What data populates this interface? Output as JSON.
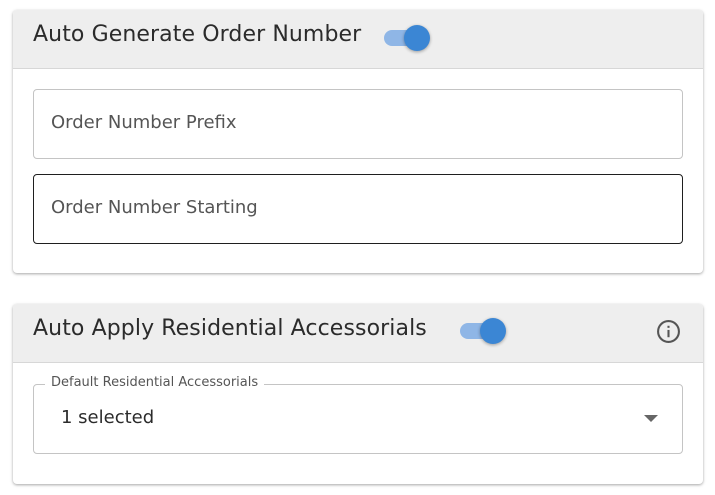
{
  "auto_order": {
    "title": "Auto Generate Order Number",
    "toggle_on": true,
    "prefix_placeholder": "Order Number Prefix",
    "starting_placeholder": "Order Number Starting"
  },
  "residential": {
    "title": "Auto Apply Residential Accessorials",
    "toggle_on": true,
    "info_icon": "info-icon",
    "select_label": "Default Residential Accessorials",
    "select_value": "1 selected"
  },
  "colors": {
    "accent": "#3b86d4",
    "accent_track": "#8fb6e6",
    "header_bg": "#eeeeee"
  }
}
